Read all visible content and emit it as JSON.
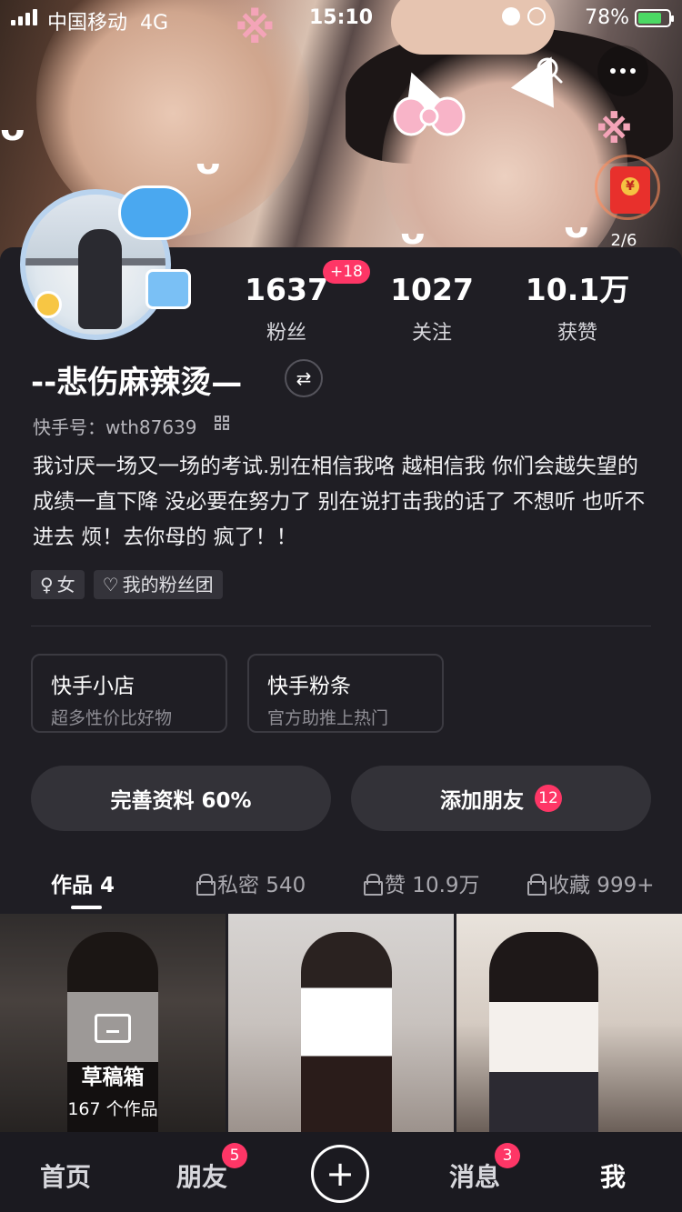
{
  "status_bar": {
    "carrier": "中国移动",
    "network": "4G",
    "time": "15:10",
    "battery": "78%",
    "battery_level": 0.78
  },
  "header": {
    "red_packet_count": "2/6"
  },
  "profile": {
    "stats": [
      {
        "value": "1637",
        "label": "粉丝",
        "badge": "+18"
      },
      {
        "value": "1027",
        "label": "关注"
      },
      {
        "value": "10.1万",
        "label": "获赞"
      }
    ],
    "nickname": "--悲伤麻辣烫—",
    "kuaishou_id": "快手号：wth87639",
    "bio": "我讨厌一场又一场的考试.别在相信我咯 越相信我 你们会越失望的 成绩一直下降 没必要在努力了 别在说打击我的话了 不想听 也听不进去 烦！去你母的 疯了！！",
    "tags": [
      {
        "icon": "female-icon",
        "label": "女"
      },
      {
        "icon": "heart-icon",
        "label": "我的粉丝团"
      }
    ]
  },
  "cards": [
    {
      "title": "快手小店",
      "subtitle": "超多性价比好物"
    },
    {
      "title": "快手粉条",
      "subtitle": "官方助推上热门"
    }
  ],
  "actions": {
    "complete_profile": "完善资料 60%",
    "add_friends": "添加朋友",
    "add_friends_count": "12"
  },
  "tabs": [
    {
      "label": "作品 4",
      "active": true,
      "locked": false
    },
    {
      "label": "私密 540",
      "active": false,
      "locked": true
    },
    {
      "label": "赞 10.9万",
      "active": false,
      "locked": true
    },
    {
      "label": "收藏 999+",
      "active": false,
      "locked": true
    }
  ],
  "grid": {
    "draft_title": "草稿箱",
    "draft_count": "167 个作品"
  },
  "bottom_nav": [
    {
      "label": "首页"
    },
    {
      "label": "朋友",
      "badge": "5"
    },
    {
      "label": "消息",
      "badge": "3"
    },
    {
      "label": "我",
      "active": true
    }
  ],
  "colors": {
    "background": "#1f1e24",
    "badge": "#fe3666",
    "card_border": "#3b3a41"
  }
}
